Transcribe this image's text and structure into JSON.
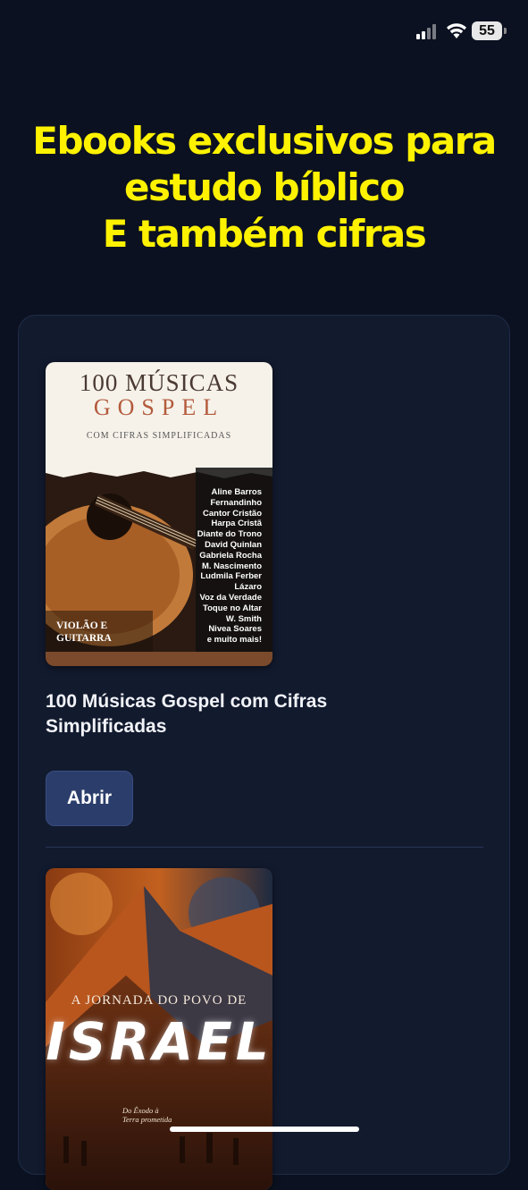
{
  "status_bar": {
    "battery": "55",
    "signal_icon": "cellular-signal-icon",
    "wifi_icon": "wifi-icon"
  },
  "headline": {
    "line1": "Ebooks exclusivos para",
    "line2": "estudo bíblico",
    "line3": "E também cifras"
  },
  "books": [
    {
      "title": "100 Músicas Gospel com Cifras Simplificadas",
      "button_label": "Abrir",
      "cover": {
        "title_line1": "100 MÚSICAS",
        "title_line2": "GOSPEL",
        "subtitle": "COM CIFRAS SIMPLIFICADAS",
        "artists": [
          "Aline Barros",
          "Fernandinho",
          "Cantor Cristão",
          "Harpa Cristã",
          "Diante do Trono",
          "David Quinlan",
          "Gabriela Rocha",
          "M. Nascimento",
          "Ludmila Ferber",
          "Lázaro",
          "Voz da Verdade",
          "Toque no Altar",
          "W. Smith",
          "Nivea Soares",
          "e muito mais!"
        ],
        "footer_line1": "VIOLÃO E",
        "footer_line2": "GUITARRA"
      }
    },
    {
      "cover": {
        "title_line1": "A JORNADA DO POVO DE",
        "title_line2": "ISRAEL",
        "subtitle_line1": "Do Êxodo à",
        "subtitle_line2": "Terra prometida"
      }
    }
  ]
}
